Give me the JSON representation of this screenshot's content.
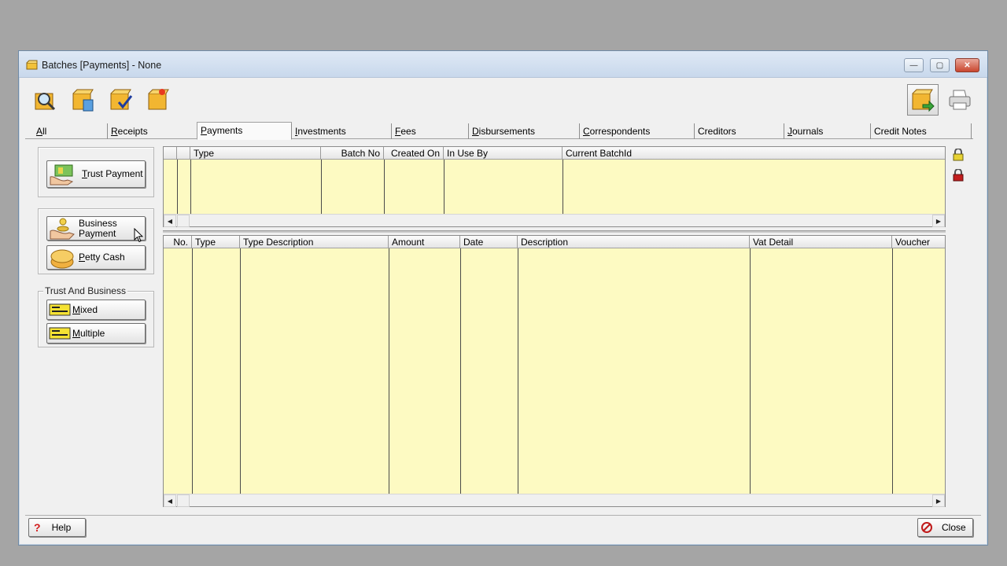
{
  "window": {
    "title": "Batches [Payments] - None",
    "controls": {
      "minimize": "—",
      "maximize": "▢",
      "close": "✕"
    }
  },
  "toolbar": {
    "left_icons": [
      "search-icon",
      "calculator-box-icon",
      "approve-box-icon",
      "new-box-icon"
    ],
    "right_icons": [
      "export-box-icon",
      "printer-icon"
    ]
  },
  "tabs": [
    {
      "label": "All",
      "u": "A",
      "rest": "ll"
    },
    {
      "label": "Receipts",
      "u": "R",
      "rest": "eceipts"
    },
    {
      "label": "Payments",
      "u": "P",
      "rest": "ayments",
      "active": true
    },
    {
      "label": "Investments",
      "u": "I",
      "rest": "nvestments"
    },
    {
      "label": "Fees",
      "u": "F",
      "rest": "ees"
    },
    {
      "label": "Disbursements",
      "u": "D",
      "rest": "isbursements"
    },
    {
      "label": "Correspondents",
      "u": "C",
      "rest": "orrespondents"
    },
    {
      "label": "Creditors",
      "u": "",
      "rest": "Creditors"
    },
    {
      "label": "Journals",
      "u": "J",
      "rest": "ournals"
    },
    {
      "label": "Credit Notes",
      "u": "",
      "rest": "Credit Notes"
    }
  ],
  "side_buttons": {
    "trust_payment": {
      "u": "T",
      "rest": "rust Payment"
    },
    "business_payment": {
      "line1": "Business",
      "line2": "Payment"
    },
    "petty_cash": {
      "u": "P",
      "rest": "etty Cash"
    },
    "group_label": "Trust And Business",
    "mixed": {
      "u": "M",
      "rest": "ixed"
    },
    "multiple": {
      "u": "M",
      "rest": "ultiple"
    }
  },
  "batch_grid": {
    "columns": [
      "Type",
      "Batch No",
      "Created On",
      "In Use By",
      "Current BatchId"
    ]
  },
  "detail_grid": {
    "columns": [
      "No.",
      "Type",
      "Type Description",
      "Amount",
      "Date",
      "Description",
      "Vat Detail",
      "Voucher"
    ]
  },
  "footer": {
    "help_label": "Help",
    "close_label": "Close"
  },
  "colors": {
    "grid_bg": "#fdfac2",
    "titlebar": "#c8d8ec"
  }
}
